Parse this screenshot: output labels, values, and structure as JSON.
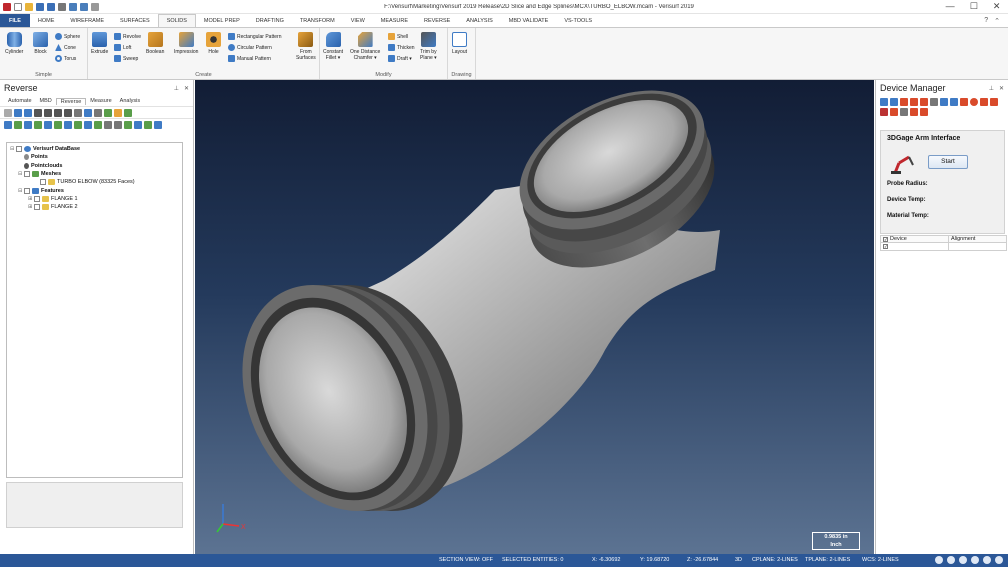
{
  "window": {
    "title": "F:\\Verisurf\\Marketing\\Verisurf 2019 Release\\2D Slice and Edge Splines\\MCX\\TURBO_ELBOW.mcam - Verisurf 2019",
    "minimize": "—",
    "maximize": "☐",
    "close": "✕"
  },
  "ribbon_tabs": [
    "FILE",
    "HOME",
    "WIREFRAME",
    "SURFACES",
    "SOLIDS",
    "MODEL PREP",
    "DRAFTING",
    "TRANSFORM",
    "VIEW",
    "MEASURE",
    "REVERSE",
    "ANALYSIS",
    "MBD VALIDATE",
    "VS-TOOLS"
  ],
  "ribbon": {
    "simple": {
      "label": "Simple",
      "cylinder": "Cylinder",
      "block": "Block",
      "sphere": "Sphere",
      "cone": "Cone",
      "torus": "Torus"
    },
    "create": {
      "label": "Create",
      "extrude": "Extrude",
      "revolve": "Revolve",
      "loft": "Loft",
      "sweep": "Sweep",
      "boolean": "Boolean",
      "impression": "Impression",
      "hole": "Hole",
      "rect_pattern": "Rectangular Pattern",
      "circ_pattern": "Circular Pattern",
      "manual_pattern": "Manual Pattern",
      "from_surfaces_1": "From",
      "from_surfaces_2": "Surfaces"
    },
    "modify": {
      "label": "Modify",
      "constant_fillet_1": "Constant",
      "constant_fillet_2": "Fillet ▾",
      "one_distance_1": "One Distance",
      "one_distance_2": "Chamfer ▾",
      "shell": "Shell",
      "thicken": "Thicken",
      "draft": "Draft ▾",
      "trim_1": "Trim by",
      "trim_2": "Plane ▾"
    },
    "drawing": {
      "label": "Drawing",
      "layout": "Layout"
    }
  },
  "left_panel": {
    "title": "Reverse",
    "pin": "⊥",
    "close": "✕",
    "tabs": [
      "Automate",
      "MBD",
      "Reverse",
      "Measure",
      "Analysis"
    ],
    "tree": {
      "root": "Verisurf DataBase",
      "points": "Points",
      "pointclouds": "Pointclouds",
      "meshes": "Meshes",
      "mesh_item": "TURBO ELBOW (83325 Faces)",
      "features": "Features",
      "flange1": "FLANGE 1",
      "flange2": "FLANGE 2"
    }
  },
  "right_panel": {
    "title": "Device Manager",
    "pin": "⊥",
    "close": "✕",
    "arm_title": "3DGage Arm Interface",
    "start": "Start",
    "probe_radius": "Probe Radius:",
    "device_temp": "Device Temp:",
    "material_temp": "Material Temp:",
    "col_device": "Device",
    "col_alignment": "Alignment"
  },
  "viewport": {
    "scale_value": "0.9835 in",
    "scale_unit": "Inch",
    "axis_x": "X"
  },
  "status": {
    "section_view": "SECTION VIEW: OFF",
    "selected": "SELECTED ENTITIES: 0",
    "x": "X:  -6.30692",
    "y": "Y:  19.68720",
    "z": "Z:  -26.67844",
    "mode": "3D",
    "cplane": "CPLANE: 2-LINES",
    "tplane": "TPLANE: 2-LINES",
    "wcs": "WCS: 2-LINES"
  },
  "colors": {
    "accent": "#2b5797",
    "viewport_top": "#121d35",
    "viewport_bottom": "#5c7392"
  }
}
